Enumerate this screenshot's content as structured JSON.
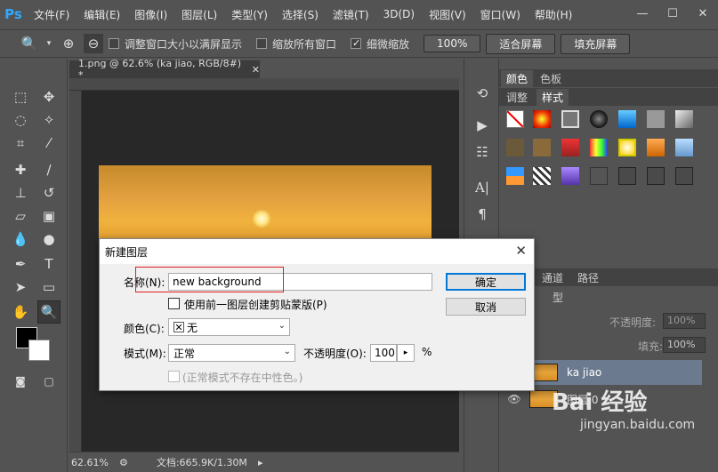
{
  "app": {
    "logo": "Ps"
  },
  "menu": [
    "文件(F)",
    "编辑(E)",
    "图像(I)",
    "图层(L)",
    "类型(Y)",
    "选择(S)",
    "滤镜(T)",
    "3D(D)",
    "视图(V)",
    "窗口(W)",
    "帮助(H)"
  ],
  "options": {
    "resize_windows": "调整窗口大小以满屏显示",
    "zoom_all": "缩放所有窗口",
    "scrubby_zoom": "细微缩放",
    "zoom_pct": "100%",
    "fit_screen": "适合屏幕",
    "fill_screen": "填充屏幕"
  },
  "document": {
    "tab_title": "1.png @ 62.6% (ka jiao, RGB/8#) *",
    "zoom": "62.61%",
    "doc_size": "文档:665.9K/1.30M"
  },
  "panels": {
    "tab_color": "颜色",
    "tab_swatches": "色板",
    "tab_adjust": "调整",
    "tab_styles": "样式",
    "tab_channels": "通道",
    "tab_paths": "路径",
    "opacity_label": "不透明度:",
    "opacity_value": "100%",
    "fill_label": "填充:",
    "fill_value": "100%",
    "blend_partial": "型"
  },
  "layers": [
    {
      "name": "ka jiao",
      "selected": true
    },
    {
      "name": "图层 0",
      "selected": false
    }
  ],
  "dialog": {
    "title": "新建图层",
    "name_label": "名称(N):",
    "name_value": "new background",
    "clip_label": "使用前一图层创建剪贴蒙版(P)",
    "color_label": "颜色(C):",
    "color_value": "无",
    "mode_label": "模式(M):",
    "mode_value": "正常",
    "opacity_label": "不透明度(O):",
    "opacity_value": "100",
    "opacity_unit": "%",
    "neutral_label": "(正常模式不存在中性色。)",
    "ok": "确定",
    "cancel": "取消"
  },
  "watermark": {
    "brand": "Bai 经验",
    "url": "jingyan.baidu.com"
  },
  "colors": {
    "dialog_primary": "#0078d7",
    "highlight": "#e02020"
  }
}
